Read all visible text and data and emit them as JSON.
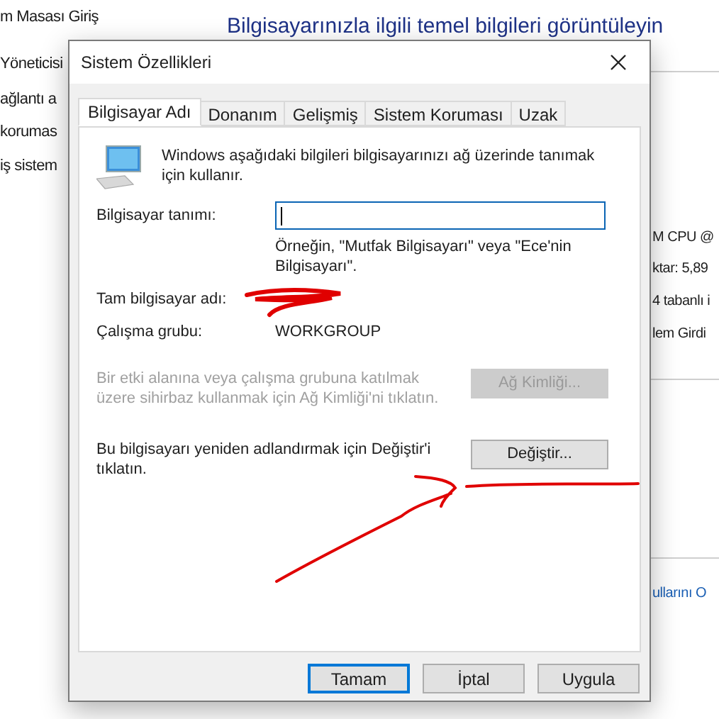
{
  "background": {
    "sidebar_links": [
      "m Masası Giriş",
      "Yöneticisi",
      "ağlantı a",
      "korumas",
      "iş sistem"
    ],
    "heading": "Bilgisayarınızla ilgili temel bilgileri görüntüleyin",
    "details": [
      "M CPU @",
      "ktar: 5,89",
      "4 tabanlı i",
      "lem Girdi"
    ],
    "link": "ullarını O"
  },
  "dialog": {
    "title": "Sistem Özellikleri",
    "tabs": [
      {
        "label": "Bilgisayar Adı",
        "selected": true
      },
      {
        "label": "Donanım",
        "selected": false
      },
      {
        "label": "Gelişmiş",
        "selected": false
      },
      {
        "label": "Sistem Koruması",
        "selected": false
      },
      {
        "label": "Uzak",
        "selected": false
      }
    ],
    "intro": "Windows aşağıdaki bilgileri bilgisayarınızı ağ üzerinde tanımak için kullanır.",
    "description_label": "Bilgisayar tanımı:",
    "description_field": {
      "focused": true
    },
    "hint": "Örneğin, \"Mutfak Bilgisayarı\" veya \"Ece'nin Bilgisayarı\".",
    "full_name_label": "Tam bilgisayar adı:",
    "workgroup_label": "Çalışma grubu:",
    "workgroup_value": "WORKGROUP",
    "actions": [
      {
        "text": "Bir etki alanına veya çalışma grubuna katılmak üzere sihirbaz kullanmak için Ağ Kimliği'ni tıklatın.",
        "button": "Ağ Kimliği...",
        "disabled": true
      },
      {
        "text": "Bu bilgisayarı yeniden adlandırmak için Değiştir'i tıklatın.",
        "button": "Değiştir...",
        "disabled": false
      }
    ],
    "buttons": [
      {
        "label": "Tamam",
        "default": true
      },
      {
        "label": "İptal",
        "default": false
      },
      {
        "label": "Uygula",
        "default": false
      }
    ]
  }
}
